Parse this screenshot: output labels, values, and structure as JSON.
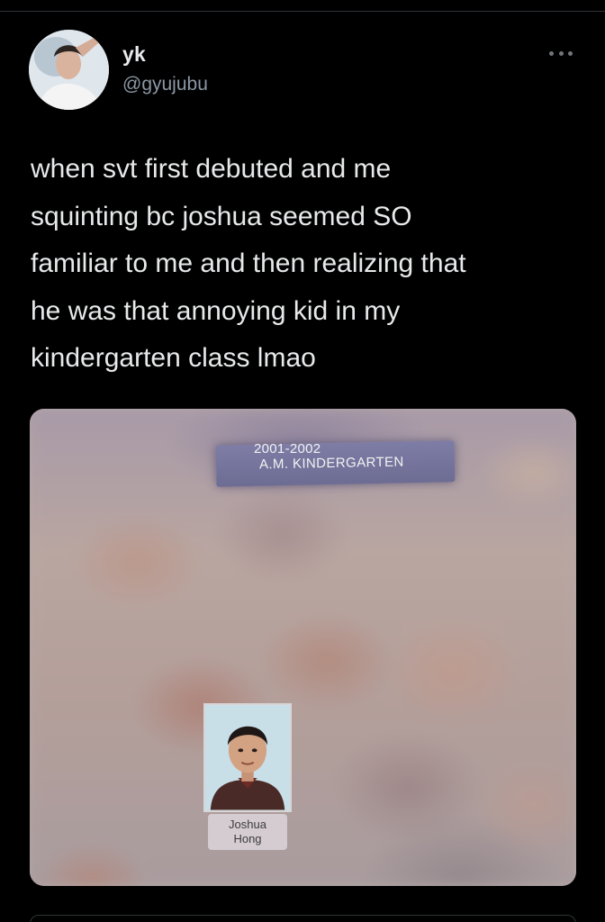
{
  "tweet": {
    "display_name": "yk",
    "handle": "@gyujubu",
    "text": "when svt first debuted and me\nsquinting bc joshua seemed SO\nfamiliar to me and then realizing that\nhe was that annoying kid in my\nkindergarten class lmao",
    "more_icon": "more-horizontal-icon"
  },
  "media": {
    "year_label": "2001-2002",
    "class_label": "A.M. KINDERGARTEN",
    "caption_first": "Joshua",
    "caption_last": "Hong"
  },
  "colors": {
    "background": "#000000",
    "text_primary": "#e7e9ea",
    "text_secondary": "#8b98a5",
    "divider": "#2f3336"
  }
}
